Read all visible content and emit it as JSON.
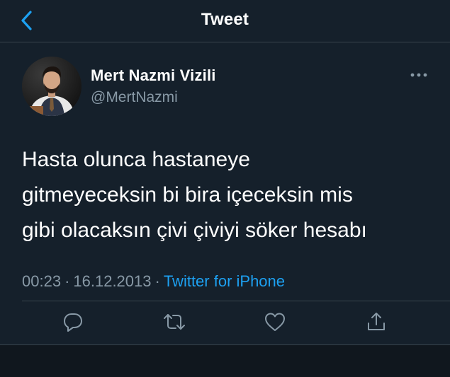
{
  "header": {
    "title": "Tweet",
    "back_icon": "chevron-left-icon"
  },
  "tweet": {
    "author": {
      "name": "Mert Nazmi Vizili",
      "handle": "@MertNazmi",
      "avatar": "avatar-photo"
    },
    "text_lines": [
      "Hasta olunca hastaneye",
      "gitmeyeceksin bi bira içeceksin mis",
      "gibi olacaksın çivi çiviyi söker hesabı"
    ],
    "time": "00:23",
    "separator": "·",
    "date": "16.12.2013",
    "source": "Twitter for iPhone",
    "more_icon": "more-horizontal-icon"
  },
  "actions": [
    {
      "icon": "reply-icon"
    },
    {
      "icon": "retweet-icon"
    },
    {
      "icon": "like-icon"
    },
    {
      "icon": "share-icon"
    }
  ],
  "colors": {
    "background": "#15202b",
    "accent": "#1da1f2",
    "muted": "#8899a6",
    "border": "#38444d"
  }
}
